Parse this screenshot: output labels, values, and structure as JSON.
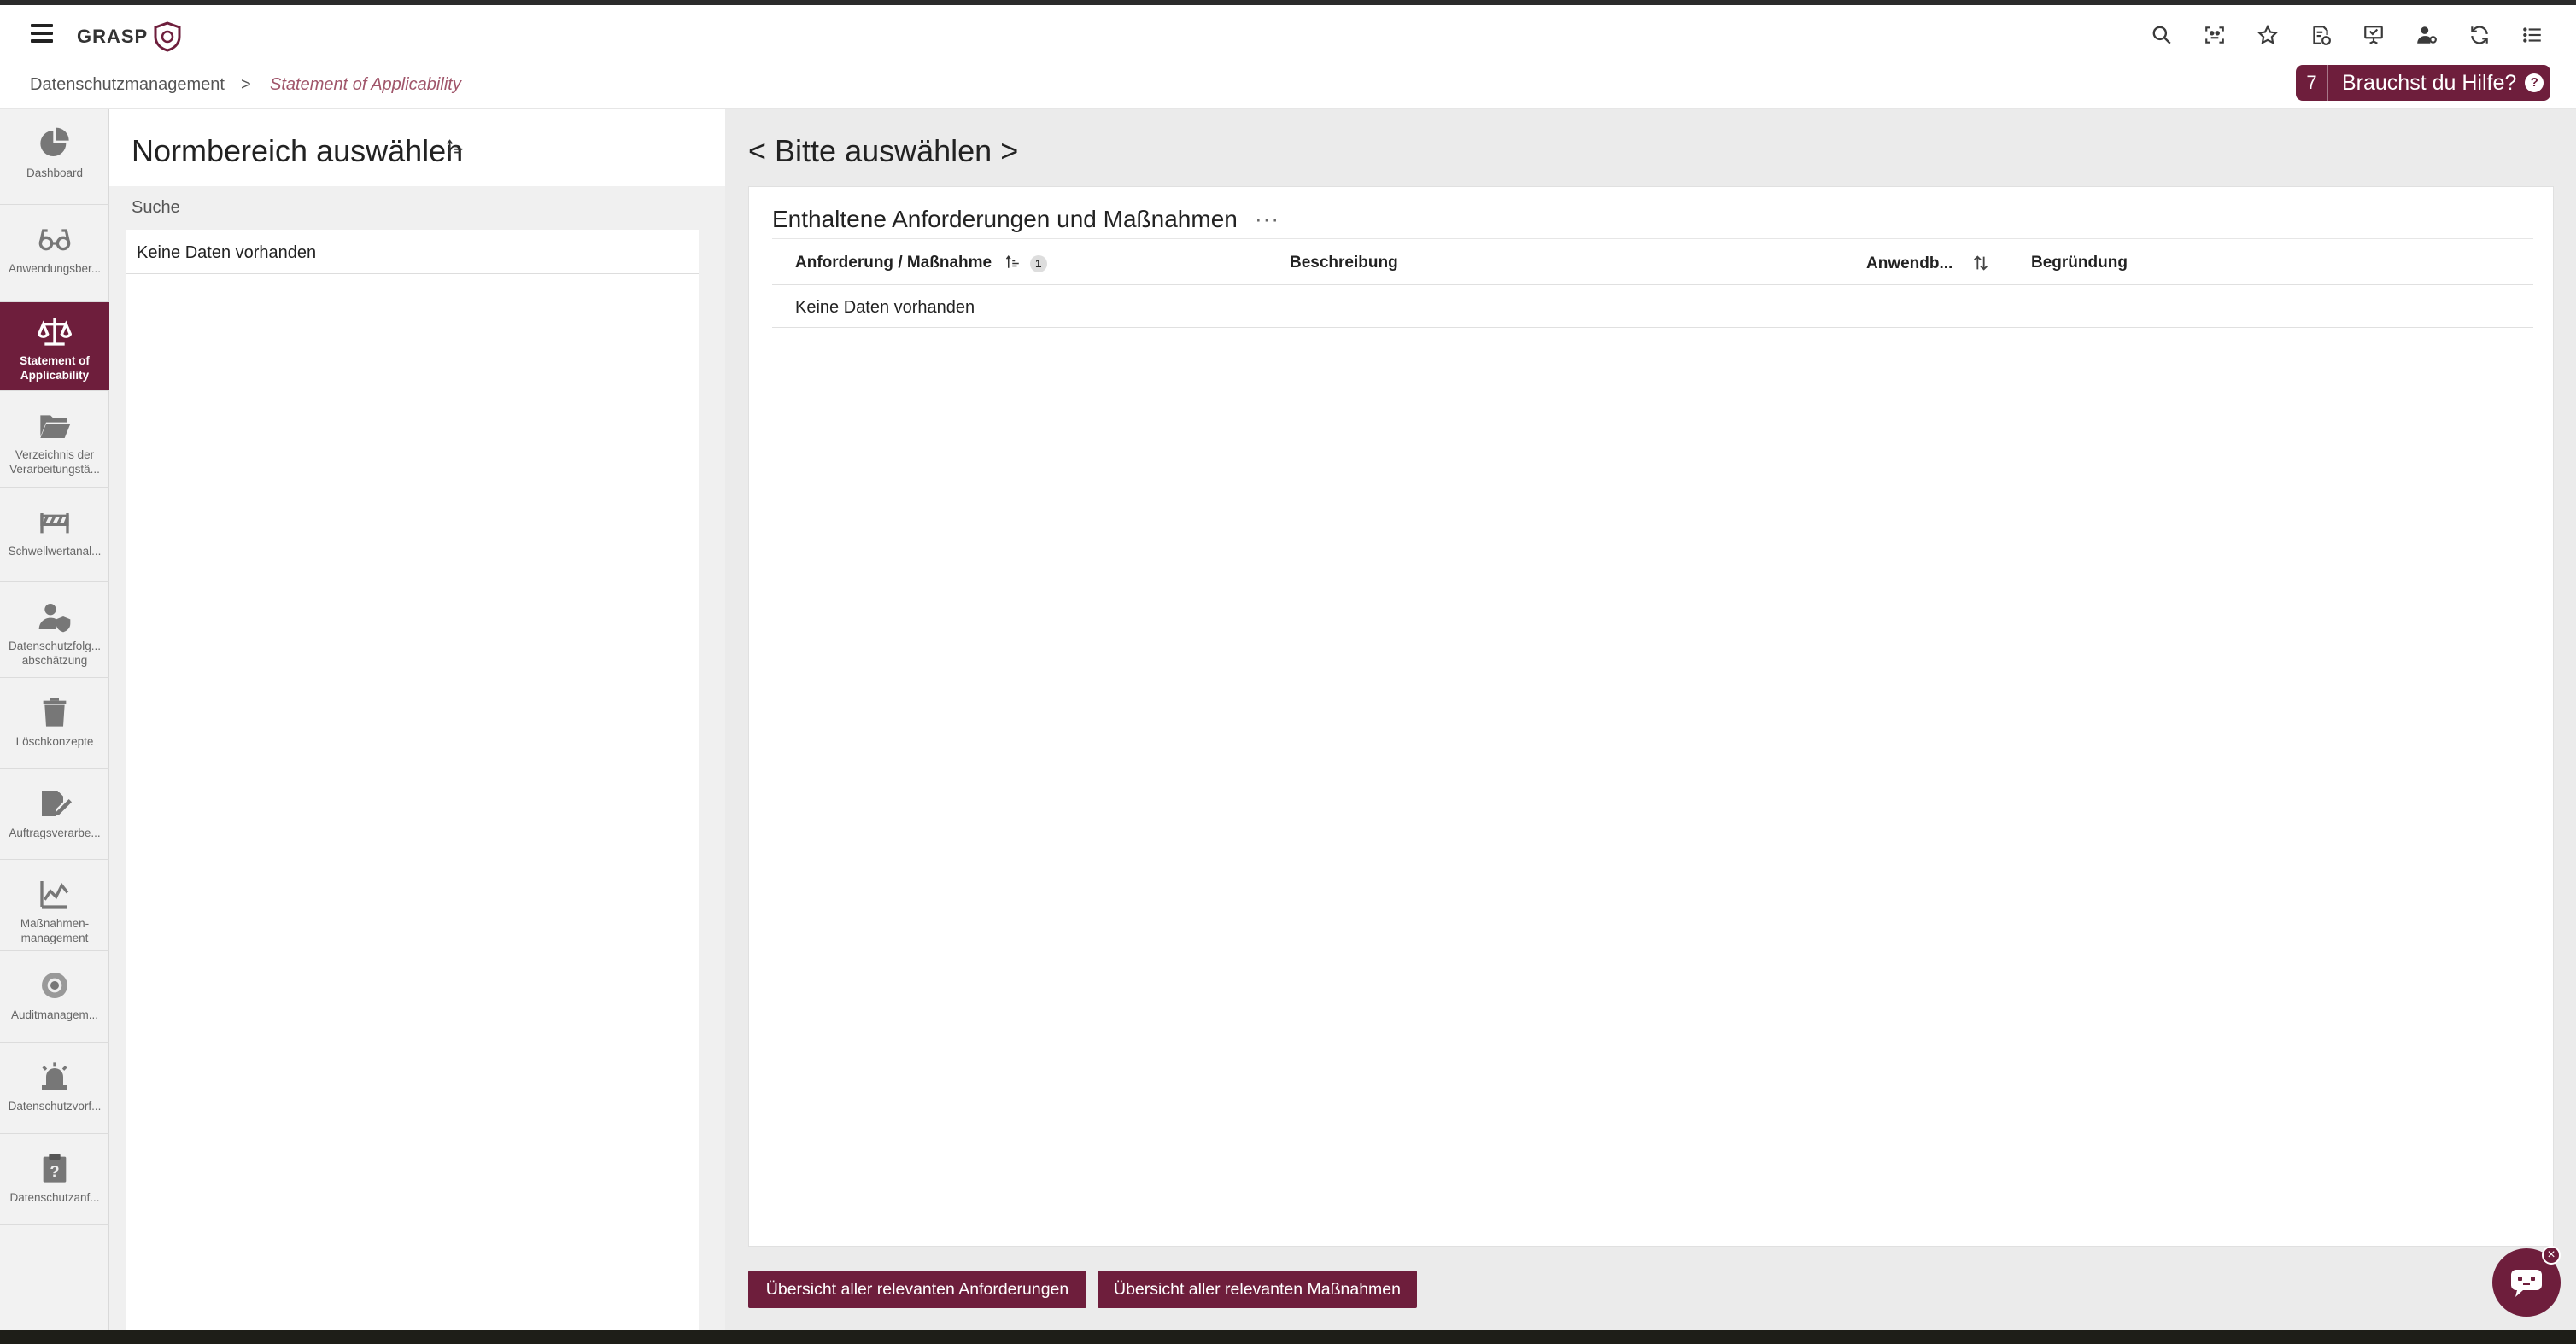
{
  "app": {
    "logo_text": "GRASP"
  },
  "topbar": {
    "icons": [
      "search-icon",
      "face-scan-icon",
      "star-icon",
      "document-info-icon",
      "presentation-icon",
      "user-settings-icon",
      "refresh-icon",
      "list-icon"
    ]
  },
  "breadcrumb": {
    "items": [
      "Datenschutzmanagement",
      "Statement of Applicability"
    ],
    "separator": ">"
  },
  "help": {
    "count": "7",
    "label": "Brauchst du Hilfe?",
    "q": "?"
  },
  "sidebar": {
    "items": [
      {
        "label": "Dashboard",
        "icon": "pie-chart-icon"
      },
      {
        "label": "Anwendungsber...",
        "icon": "glasses-icon"
      },
      {
        "label": "Statement of\nApplicability",
        "icon": "scales-icon",
        "active": true
      },
      {
        "label": "Verzeichnis der\nVerarbeitungstä...",
        "icon": "folder-icon"
      },
      {
        "label": "Schwellwertanal...",
        "icon": "barrier-icon"
      },
      {
        "label": "Datenschutzfolg...\nabschätzung",
        "icon": "user-shield-icon"
      },
      {
        "label": "Löschkonzepte",
        "icon": "trash-icon"
      },
      {
        "label": "Auftragsverarbe...",
        "icon": "signature-icon"
      },
      {
        "label": "Maßnahmen-\nmanagement",
        "icon": "line-chart-icon"
      },
      {
        "label": "Auditmanagem...",
        "icon": "eye-icon"
      },
      {
        "label": "Datenschutzvorf...",
        "icon": "alarm-icon"
      },
      {
        "label": "Datenschutzanf...",
        "icon": "clipboard-question-icon"
      }
    ]
  },
  "left_panel": {
    "title": "Normbereich auswählen",
    "search_label": "Suche",
    "empty": "Keine Daten vorhanden"
  },
  "right_panel": {
    "title": "< Bitte auswählen >",
    "card_title": "Enthaltene Anforderungen und Maßnahmen",
    "card_menu": "···",
    "columns": [
      "Anforderung / Maßnahme",
      "Beschreibung",
      "Anwendb...",
      "Begründung"
    ],
    "sort_badge": "1",
    "empty": "Keine Daten vorhanden"
  },
  "buttons": {
    "requirements": "Übersicht aller relevanten Anforderungen",
    "measures": "Übersicht aller relevanten Maßnahmen"
  },
  "chat": {
    "close": "×"
  },
  "colors": {
    "accent": "#6e1e3c",
    "breadcrumb_active": "#a0556a"
  }
}
